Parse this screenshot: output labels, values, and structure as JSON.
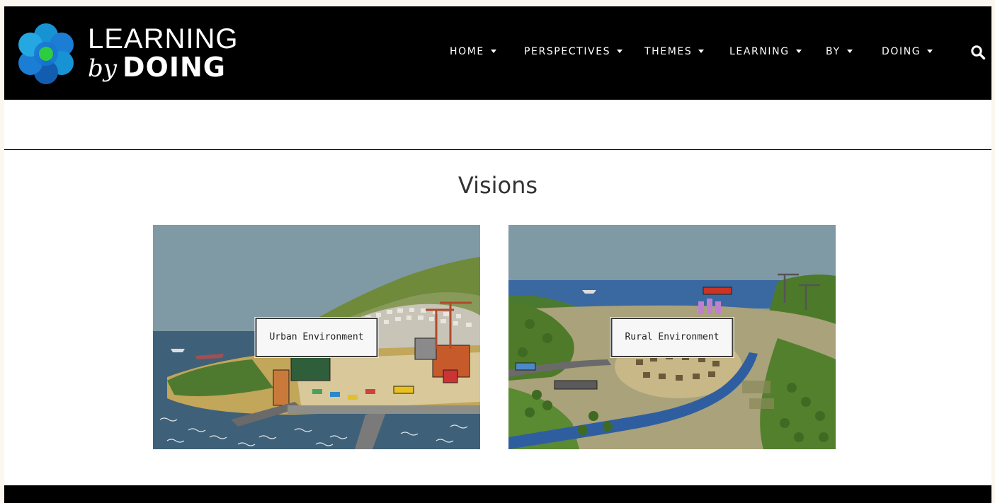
{
  "header": {
    "logo": {
      "line1": "LEARNING",
      "by": "by",
      "doing": "DOING",
      "colors": [
        "#1aa0e6",
        "#1565c0",
        "#2ecc40",
        "#4fc3f7"
      ]
    },
    "nav": [
      {
        "label": "HOME",
        "icon": "caret-down-icon"
      },
      {
        "label": "PERSPECTIVES",
        "icon": "caret-down-icon"
      },
      {
        "label": "THEMES",
        "icon": "caret-down-icon"
      },
      {
        "label": "LEARNING",
        "icon": "caret-down-icon"
      },
      {
        "label": "BY",
        "icon": "caret-down-icon"
      },
      {
        "label": "DOING",
        "icon": "caret-down-icon"
      }
    ],
    "search_icon": "search-icon"
  },
  "main": {
    "title": "Visions",
    "cards": [
      {
        "label": "Urban Environment",
        "scene": "urban-illustration"
      },
      {
        "label": "Rural Environment",
        "scene": "rural-illustration"
      }
    ]
  },
  "colors": {
    "header_bg": "#000000",
    "page_bg": "#ffffff",
    "outer_bg": "#fbf7f0",
    "sky": "#7f9aa5",
    "sea": "#3f5f7a"
  }
}
